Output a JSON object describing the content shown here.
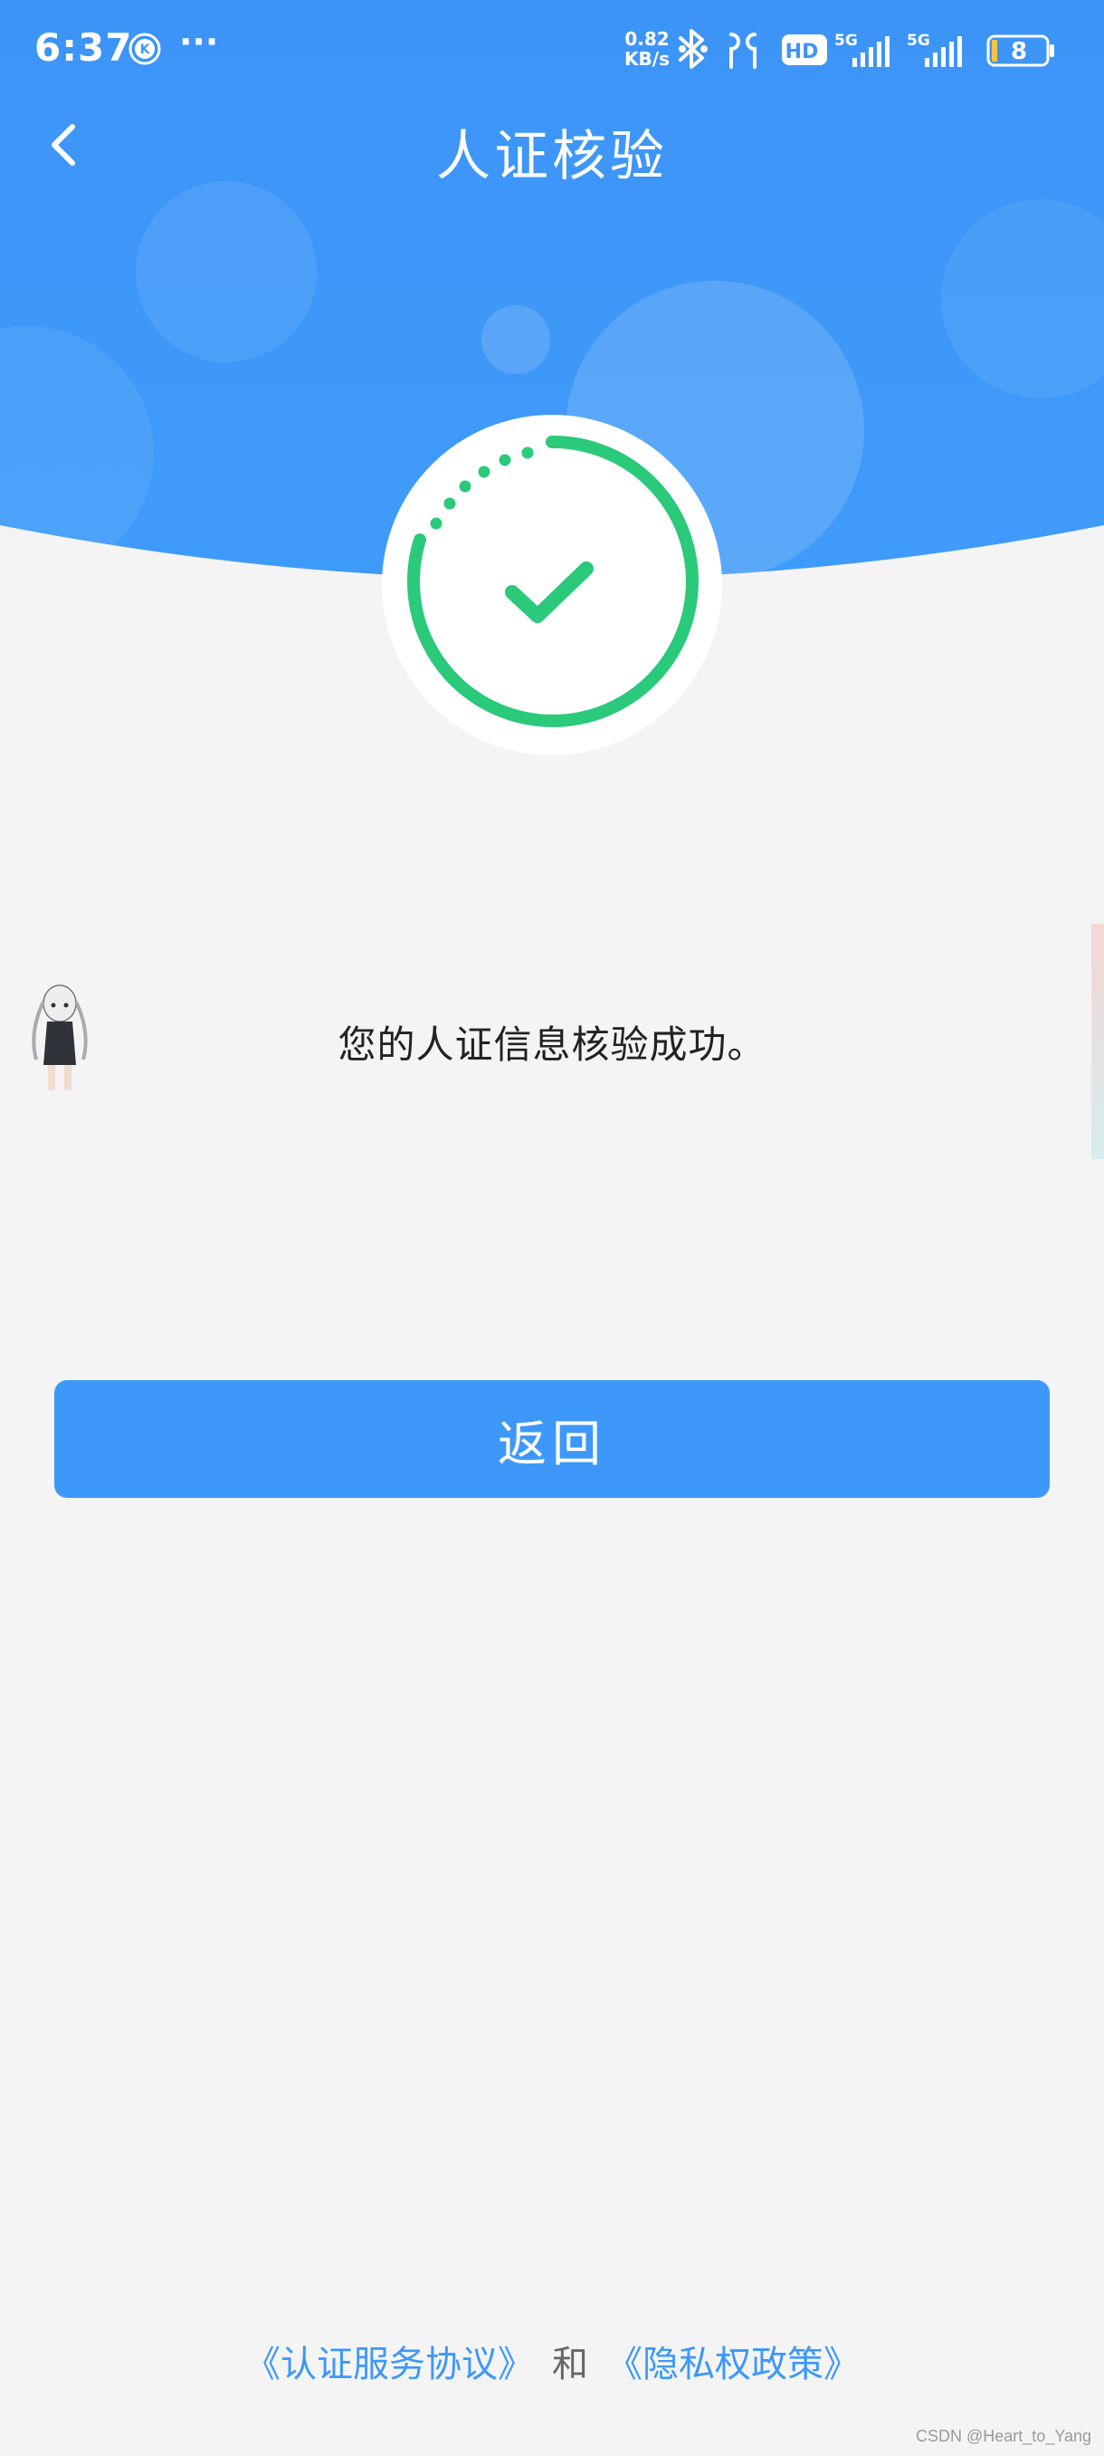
{
  "status_bar": {
    "time": "6:37",
    "more": "···",
    "net_speed_value": "0.82",
    "net_speed_unit": "KB/s",
    "hd_label": "HD",
    "sim1_label": "5G",
    "sim2_label": "5G",
    "battery": "8"
  },
  "header": {
    "title": "人证核验"
  },
  "colors": {
    "primary_blue": "#3d98f9",
    "success_green": "#2bc97a",
    "background": "#f4f4f4"
  },
  "result": {
    "message": "您的人证信息核验成功。"
  },
  "actions": {
    "return_label": "返回"
  },
  "footer": {
    "agreement_link": "《认证服务协议》",
    "and_text": "和",
    "privacy_link": "《隐私权政策》"
  },
  "watermark": "CSDN @Heart_to_Yang"
}
